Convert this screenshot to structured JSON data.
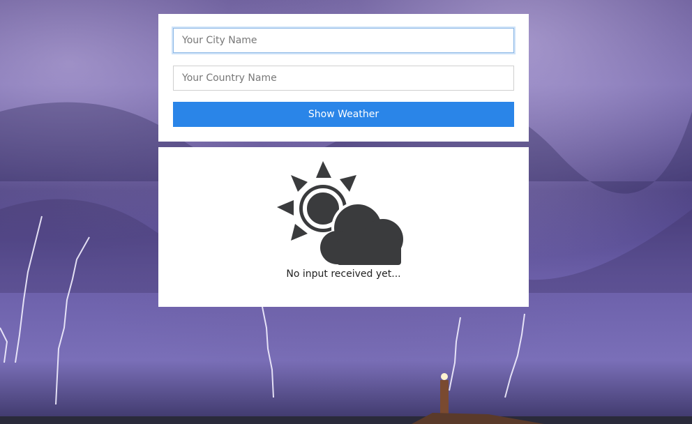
{
  "form": {
    "city_placeholder": "Your City Name",
    "country_placeholder": "Your Country Name",
    "submit_label": "Show Weather"
  },
  "result": {
    "icon": "partly-cloudy-icon",
    "status_text": "No input received yet..."
  },
  "colors": {
    "button": "#2a85e8",
    "icon": "#3a3b3d",
    "panel": "#ffffff"
  }
}
